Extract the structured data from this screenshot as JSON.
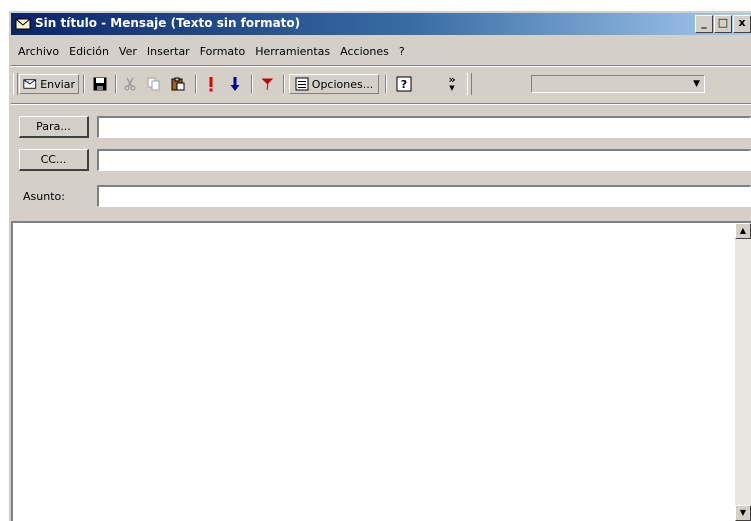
{
  "window": {
    "title": "Sin título - Mensaje (Texto sin formato)",
    "controls": [
      "_",
      "□",
      "x"
    ]
  },
  "menu": [
    {
      "label": "Archivo"
    },
    {
      "label": "Edición"
    },
    {
      "label": "Ver"
    },
    {
      "label": "Insertar"
    },
    {
      "label": "Formato"
    },
    {
      "label": "Herramientas"
    },
    {
      "label": "Acciones"
    },
    {
      "label": "?"
    }
  ],
  "toolbar": {
    "send_label": "Enviar",
    "options_label": "Opciones...",
    "overflow_label": "»",
    "combo_value": "",
    "icons": [
      "send-icon",
      "save-icon",
      "cut-icon",
      "copy-icon",
      "paste-icon",
      "importance-high-icon",
      "importance-low-icon",
      "flag-icon",
      "options-icon",
      "help-icon"
    ]
  },
  "address": {
    "to_label": "Para...",
    "cc_label": "CC...",
    "subject_label": "Asunto:",
    "to_value": "",
    "cc_value": "",
    "subject_value": ""
  },
  "body": {
    "text": ""
  },
  "colors": {
    "titlebar": "#0a246a",
    "chrome": "#d4d0c8",
    "flag": "#c00000",
    "arrow": "#0000a0"
  }
}
